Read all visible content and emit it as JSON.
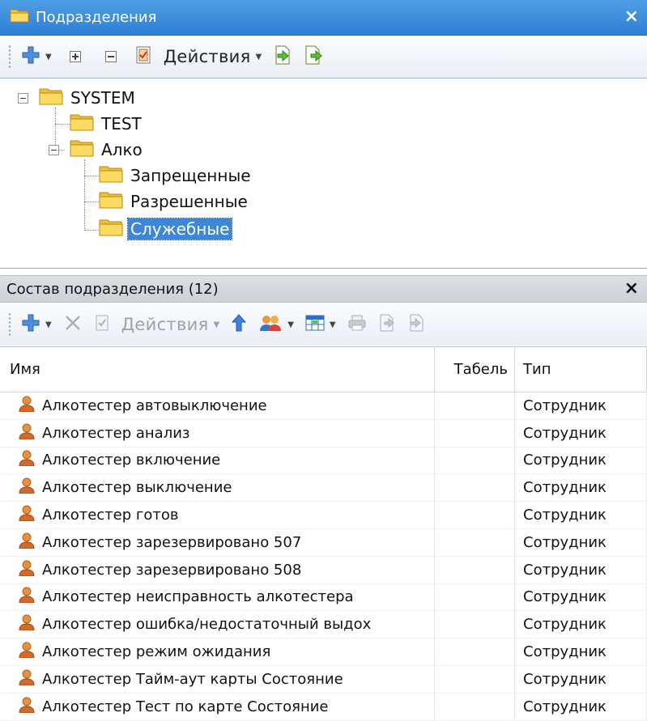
{
  "top_panel": {
    "title": "Подразделения",
    "close": "×",
    "toolbar": {
      "actions_label": "Действия"
    }
  },
  "tree": {
    "nodes": [
      {
        "label": "SYSTEM"
      },
      {
        "label": "TEST"
      },
      {
        "label": "Алко"
      },
      {
        "label": "Запрещенные"
      },
      {
        "label": "Разрешенные"
      },
      {
        "label": "Служебные",
        "selected": true
      }
    ]
  },
  "bottom_panel": {
    "title": "Состав подразделения (12)",
    "close": "×",
    "toolbar": {
      "actions_label": "Действия"
    }
  },
  "grid": {
    "columns": [
      "Имя",
      "Табель",
      "Тип"
    ],
    "rows": [
      {
        "name": "Алкотестер автовыключение",
        "tabel": "",
        "type": "Сотрудник"
      },
      {
        "name": "Алкотестер анализ",
        "tabel": "",
        "type": "Сотрудник"
      },
      {
        "name": "Алкотестер включение",
        "tabel": "",
        "type": "Сотрудник"
      },
      {
        "name": "Алкотестер выключение",
        "tabel": "",
        "type": "Сотрудник"
      },
      {
        "name": "Алкотестер готов",
        "tabel": "",
        "type": "Сотрудник"
      },
      {
        "name": "Алкотестер зарезервировано 507",
        "tabel": "",
        "type": "Сотрудник"
      },
      {
        "name": "Алкотестер зарезервировано 508",
        "tabel": "",
        "type": "Сотрудник"
      },
      {
        "name": "Алкотестер неисправность алкотестера",
        "tabel": "",
        "type": "Сотрудник"
      },
      {
        "name": "Алкотестер ошибка/недостаточный выдох",
        "tabel": "",
        "type": "Сотрудник"
      },
      {
        "name": "Алкотестер режим ожидания",
        "tabel": "",
        "type": "Сотрудник"
      },
      {
        "name": "Алкотестер Тайм-аут карты Состояние",
        "tabel": "",
        "type": "Сотрудник"
      },
      {
        "name": "Алкотестер Тест по карте Состояние",
        "tabel": "",
        "type": "Сотрудник"
      }
    ]
  },
  "colors": {
    "title_bar": "#3b8ee0",
    "selection": "#3e86d6"
  },
  "icons": [
    "folder-icon",
    "add-icon",
    "expand-all-icon",
    "collapse-all-icon",
    "check-doc-icon",
    "import-icon",
    "export-icon",
    "delete-icon",
    "up-arrow-icon",
    "users-icon",
    "grid-view-icon",
    "print-icon",
    "person-icon"
  ]
}
